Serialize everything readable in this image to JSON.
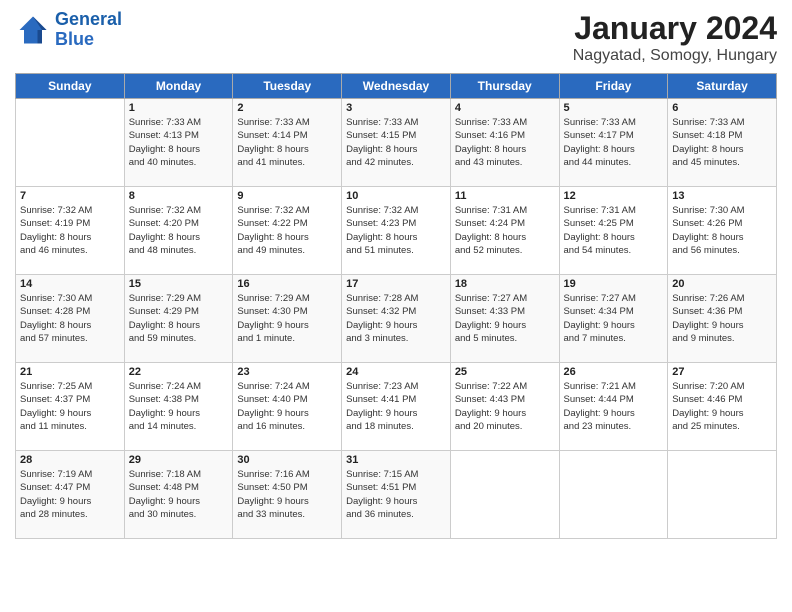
{
  "header": {
    "logo_line1": "General",
    "logo_line2": "Blue",
    "month": "January 2024",
    "location": "Nagyatad, Somogy, Hungary"
  },
  "days_of_week": [
    "Sunday",
    "Monday",
    "Tuesday",
    "Wednesday",
    "Thursday",
    "Friday",
    "Saturday"
  ],
  "weeks": [
    [
      {
        "day": "",
        "info": ""
      },
      {
        "day": "1",
        "info": "Sunrise: 7:33 AM\nSunset: 4:13 PM\nDaylight: 8 hours\nand 40 minutes."
      },
      {
        "day": "2",
        "info": "Sunrise: 7:33 AM\nSunset: 4:14 PM\nDaylight: 8 hours\nand 41 minutes."
      },
      {
        "day": "3",
        "info": "Sunrise: 7:33 AM\nSunset: 4:15 PM\nDaylight: 8 hours\nand 42 minutes."
      },
      {
        "day": "4",
        "info": "Sunrise: 7:33 AM\nSunset: 4:16 PM\nDaylight: 8 hours\nand 43 minutes."
      },
      {
        "day": "5",
        "info": "Sunrise: 7:33 AM\nSunset: 4:17 PM\nDaylight: 8 hours\nand 44 minutes."
      },
      {
        "day": "6",
        "info": "Sunrise: 7:33 AM\nSunset: 4:18 PM\nDaylight: 8 hours\nand 45 minutes."
      }
    ],
    [
      {
        "day": "7",
        "info": "Sunrise: 7:32 AM\nSunset: 4:19 PM\nDaylight: 8 hours\nand 46 minutes."
      },
      {
        "day": "8",
        "info": "Sunrise: 7:32 AM\nSunset: 4:20 PM\nDaylight: 8 hours\nand 48 minutes."
      },
      {
        "day": "9",
        "info": "Sunrise: 7:32 AM\nSunset: 4:22 PM\nDaylight: 8 hours\nand 49 minutes."
      },
      {
        "day": "10",
        "info": "Sunrise: 7:32 AM\nSunset: 4:23 PM\nDaylight: 8 hours\nand 51 minutes."
      },
      {
        "day": "11",
        "info": "Sunrise: 7:31 AM\nSunset: 4:24 PM\nDaylight: 8 hours\nand 52 minutes."
      },
      {
        "day": "12",
        "info": "Sunrise: 7:31 AM\nSunset: 4:25 PM\nDaylight: 8 hours\nand 54 minutes."
      },
      {
        "day": "13",
        "info": "Sunrise: 7:30 AM\nSunset: 4:26 PM\nDaylight: 8 hours\nand 56 minutes."
      }
    ],
    [
      {
        "day": "14",
        "info": "Sunrise: 7:30 AM\nSunset: 4:28 PM\nDaylight: 8 hours\nand 57 minutes."
      },
      {
        "day": "15",
        "info": "Sunrise: 7:29 AM\nSunset: 4:29 PM\nDaylight: 8 hours\nand 59 minutes."
      },
      {
        "day": "16",
        "info": "Sunrise: 7:29 AM\nSunset: 4:30 PM\nDaylight: 9 hours\nand 1 minute."
      },
      {
        "day": "17",
        "info": "Sunrise: 7:28 AM\nSunset: 4:32 PM\nDaylight: 9 hours\nand 3 minutes."
      },
      {
        "day": "18",
        "info": "Sunrise: 7:27 AM\nSunset: 4:33 PM\nDaylight: 9 hours\nand 5 minutes."
      },
      {
        "day": "19",
        "info": "Sunrise: 7:27 AM\nSunset: 4:34 PM\nDaylight: 9 hours\nand 7 minutes."
      },
      {
        "day": "20",
        "info": "Sunrise: 7:26 AM\nSunset: 4:36 PM\nDaylight: 9 hours\nand 9 minutes."
      }
    ],
    [
      {
        "day": "21",
        "info": "Sunrise: 7:25 AM\nSunset: 4:37 PM\nDaylight: 9 hours\nand 11 minutes."
      },
      {
        "day": "22",
        "info": "Sunrise: 7:24 AM\nSunset: 4:38 PM\nDaylight: 9 hours\nand 14 minutes."
      },
      {
        "day": "23",
        "info": "Sunrise: 7:24 AM\nSunset: 4:40 PM\nDaylight: 9 hours\nand 16 minutes."
      },
      {
        "day": "24",
        "info": "Sunrise: 7:23 AM\nSunset: 4:41 PM\nDaylight: 9 hours\nand 18 minutes."
      },
      {
        "day": "25",
        "info": "Sunrise: 7:22 AM\nSunset: 4:43 PM\nDaylight: 9 hours\nand 20 minutes."
      },
      {
        "day": "26",
        "info": "Sunrise: 7:21 AM\nSunset: 4:44 PM\nDaylight: 9 hours\nand 23 minutes."
      },
      {
        "day": "27",
        "info": "Sunrise: 7:20 AM\nSunset: 4:46 PM\nDaylight: 9 hours\nand 25 minutes."
      }
    ],
    [
      {
        "day": "28",
        "info": "Sunrise: 7:19 AM\nSunset: 4:47 PM\nDaylight: 9 hours\nand 28 minutes."
      },
      {
        "day": "29",
        "info": "Sunrise: 7:18 AM\nSunset: 4:48 PM\nDaylight: 9 hours\nand 30 minutes."
      },
      {
        "day": "30",
        "info": "Sunrise: 7:16 AM\nSunset: 4:50 PM\nDaylight: 9 hours\nand 33 minutes."
      },
      {
        "day": "31",
        "info": "Sunrise: 7:15 AM\nSunset: 4:51 PM\nDaylight: 9 hours\nand 36 minutes."
      },
      {
        "day": "",
        "info": ""
      },
      {
        "day": "",
        "info": ""
      },
      {
        "day": "",
        "info": ""
      }
    ]
  ]
}
